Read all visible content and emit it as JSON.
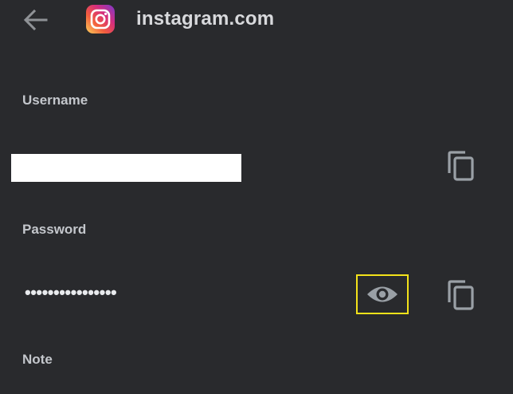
{
  "header": {
    "back_icon": "arrow-back-icon",
    "site_icon": "instagram-logo-icon",
    "site_title": "instagram.com"
  },
  "username": {
    "label": "Username",
    "copy_icon": "copy-icon"
  },
  "password": {
    "label": "Password",
    "masked_value": "••••••••••••••••",
    "reveal_icon": "eye-icon",
    "copy_icon": "copy-icon"
  },
  "note": {
    "label": "Note"
  },
  "colors": {
    "background": "#292a2d",
    "text": "#e8eaed",
    "icon": "#9aa0a6",
    "highlight": "#f4e21a"
  }
}
